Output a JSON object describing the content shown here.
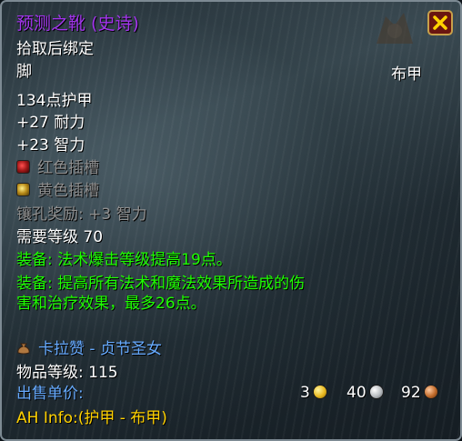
{
  "item": {
    "name": "预测之靴 (史诗)",
    "bind": "拾取后绑定",
    "slot": "脚",
    "type": "布甲",
    "armor": "134点护甲",
    "stat1": "+27 耐力",
    "stat2": "+23 智力",
    "socket_red": "红色插槽",
    "socket_yellow": "黄色插槽",
    "socket_bonus": "镶孔奖励: +3 智力",
    "required_level": "需要等级 70",
    "equip1": "装备: 法术爆击等级提高19点。",
    "equip2_line1": "装备: 提高所有法术和魔法效果所造成的伤",
    "equip2_line2": "害和治疗效果，最多26点。",
    "source": "卡拉赞 - 贞节圣女",
    "item_level": "物品等级: 115",
    "sell_label": "出售单价:",
    "gold": "3",
    "silver": "40",
    "copper": "92",
    "ah_info": "AH Info:(护甲 - 布甲)"
  },
  "colors": {
    "epic": "#a335ee",
    "green": "#1eff00",
    "gold_text": "#ffd100",
    "blue_text": "#66aaff",
    "grey_text": "#8f8f8f"
  },
  "icons": {
    "close": "close-x-icon",
    "socket_red": "red-socket-icon",
    "socket_yellow": "yellow-socket-icon",
    "source": "loot-bag-icon",
    "gold": "gold-coin-icon",
    "silver": "silver-coin-icon",
    "copper": "copper-coin-icon"
  }
}
